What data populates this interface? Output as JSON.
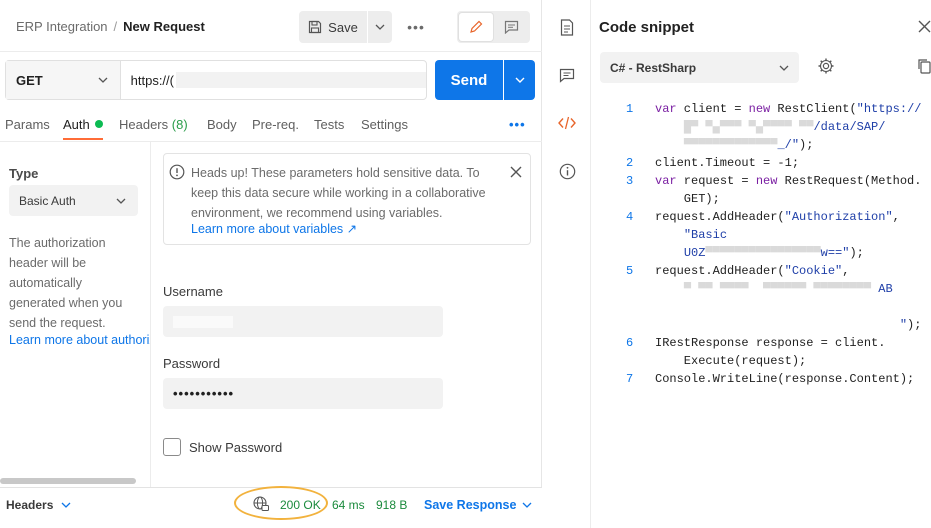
{
  "breadcrumb": {
    "parent": "ERP Integration",
    "separator": "/",
    "current": "New Request"
  },
  "toolbar": {
    "save_label": "Save",
    "more": "•••"
  },
  "request": {
    "method": "GET",
    "url": "https://(",
    "send_label": "Send"
  },
  "tabs": [
    {
      "label": "Params"
    },
    {
      "label": "Auth"
    },
    {
      "label": "Headers",
      "count": "(8)"
    },
    {
      "label": "Body"
    },
    {
      "label": "Pre-req."
    },
    {
      "label": "Tests"
    },
    {
      "label": "Settings"
    }
  ],
  "tabs_more": "•••",
  "auth": {
    "type_label": "Type",
    "type_value": "Basic Auth",
    "description": "The authorization header will be automatically generated when you send the request.",
    "link": "Learn more about authorization"
  },
  "notice": {
    "text": "Heads up! These parameters hold sensitive data. To keep this data secure while working in a collaborative environment, we recommend using variables.",
    "link": "Learn more about variables ↗"
  },
  "fields": {
    "username_label": "Username",
    "password_label": "Password",
    "password_value": "•••••••••••",
    "show_password_label": "Show Password"
  },
  "response_bar": {
    "headers_label": "Headers",
    "status": "200 OK",
    "time": "64 ms",
    "size": "918 B",
    "save_response": "Save Response"
  },
  "snippet": {
    "title": "Code snippet",
    "language": "C# - RestSharp",
    "lines": [
      {
        "n": "1",
        "text": "var client = new RestClient(\"https://"
      },
      {
        "n": "2",
        "text": "client.Timeout = -1;"
      },
      {
        "n": "3",
        "text": "var request = new RestRequest(Method.GET);"
      },
      {
        "n": "4",
        "text": "request.AddHeader(\"Authorization\", \"Basic U0Z...w==\");"
      },
      {
        "n": "5",
        "text": "request.AddHeader(\"Cookie\", \"...AB\");"
      },
      {
        "n": "6",
        "text": "IRestResponse response = client.Execute(request);"
      },
      {
        "n": "7",
        "text": "Console.WriteLine(response.Content);"
      }
    ]
  },
  "colors": {
    "accent": "#0e76e8",
    "active_tab": "#ff6c37",
    "success": "#1a8a3c",
    "highlight": "#f2b23d"
  }
}
